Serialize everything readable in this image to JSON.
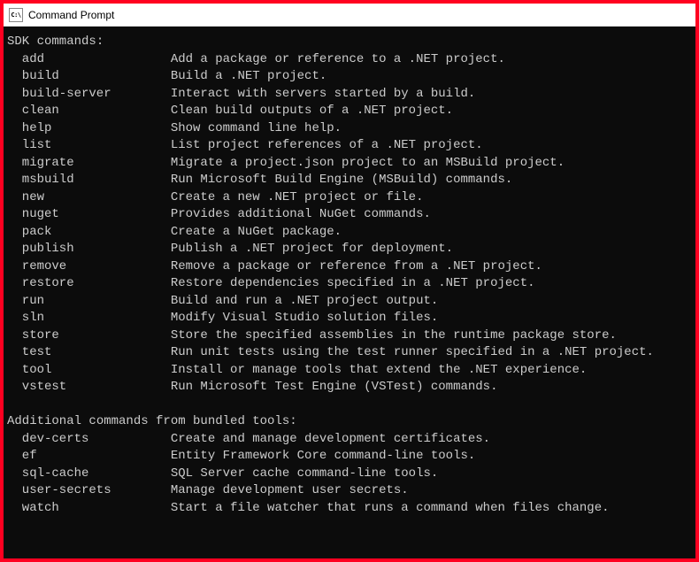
{
  "window": {
    "title": "Command Prompt",
    "icon_label": "C:\\"
  },
  "sections": [
    {
      "header": "SDK commands:",
      "commands": [
        {
          "name": "add",
          "desc": "Add a package or reference to a .NET project."
        },
        {
          "name": "build",
          "desc": "Build a .NET project."
        },
        {
          "name": "build-server",
          "desc": "Interact with servers started by a build."
        },
        {
          "name": "clean",
          "desc": "Clean build outputs of a .NET project."
        },
        {
          "name": "help",
          "desc": "Show command line help."
        },
        {
          "name": "list",
          "desc": "List project references of a .NET project."
        },
        {
          "name": "migrate",
          "desc": "Migrate a project.json project to an MSBuild project."
        },
        {
          "name": "msbuild",
          "desc": "Run Microsoft Build Engine (MSBuild) commands."
        },
        {
          "name": "new",
          "desc": "Create a new .NET project or file."
        },
        {
          "name": "nuget",
          "desc": "Provides additional NuGet commands."
        },
        {
          "name": "pack",
          "desc": "Create a NuGet package."
        },
        {
          "name": "publish",
          "desc": "Publish a .NET project for deployment."
        },
        {
          "name": "remove",
          "desc": "Remove a package or reference from a .NET project."
        },
        {
          "name": "restore",
          "desc": "Restore dependencies specified in a .NET project."
        },
        {
          "name": "run",
          "desc": "Build and run a .NET project output."
        },
        {
          "name": "sln",
          "desc": "Modify Visual Studio solution files."
        },
        {
          "name": "store",
          "desc": "Store the specified assemblies in the runtime package store."
        },
        {
          "name": "test",
          "desc": "Run unit tests using the test runner specified in a .NET project."
        },
        {
          "name": "tool",
          "desc": "Install or manage tools that extend the .NET experience."
        },
        {
          "name": "vstest",
          "desc": "Run Microsoft Test Engine (VSTest) commands."
        }
      ]
    },
    {
      "header": "Additional commands from bundled tools:",
      "commands": [
        {
          "name": "dev-certs",
          "desc": "Create and manage development certificates."
        },
        {
          "name": "ef",
          "desc": "Entity Framework Core command-line tools."
        },
        {
          "name": "sql-cache",
          "desc": "SQL Server cache command-line tools."
        },
        {
          "name": "user-secrets",
          "desc": "Manage development user secrets."
        },
        {
          "name": "watch",
          "desc": "Start a file watcher that runs a command when files change."
        }
      ]
    }
  ]
}
